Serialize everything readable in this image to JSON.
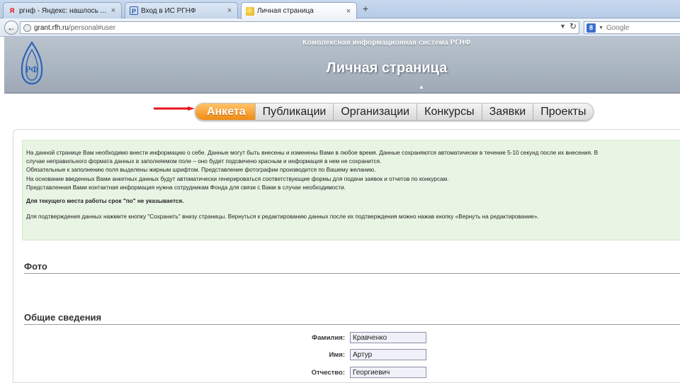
{
  "browser": {
    "tabs": [
      {
        "title": "ргнф - Яндекс: нашлось ...",
        "favicon": "yandex-icon",
        "active": false
      },
      {
        "title": "Вход в ИС РГНФ",
        "favicon": "rgnf-icon",
        "active": false
      },
      {
        "title": "Личная страница",
        "favicon": "loading-dot-icon",
        "active": true
      }
    ],
    "close_glyph": "×",
    "new_tab_glyph": "+",
    "url_host": "grant.rfh.ru",
    "url_path": "/personal#user",
    "search_placeholder": "Google"
  },
  "site": {
    "system_title": "Комплексная информационная система РГНФ",
    "page_title": "Личная страница"
  },
  "menu": {
    "items": [
      "Анкета",
      "Публикации",
      "Организации",
      "Конкурсы",
      "Заявки",
      "Проекты"
    ],
    "active_index": 0
  },
  "info": {
    "lines": [
      "На данной странице Вам необходимо внести информацию о себе. Данные могут быть внесены и изменены Вами в любое время. Данные сохраняются автоматически в течение 5-10 секунд после их внесения. В",
      "случае неправильного формата данных в заполняемом поле – оно будет подсвечено красным и информация в нем не сохранится.",
      "Обязательные к заполнению поля выделены жирным шрифтом. Представление фотографии производится по Вашему желанию.",
      "На основании введенных Вами анкетных данных будут автоматически генерироваться соответствующие формы для подачи заявок и отчетов по конкурсам.",
      "Представленная Вами контактная информация нужна сотрудникам Фонда для связи с Вами в случае необходимости."
    ],
    "bold_note": "Для текущего места работы срок \"по\" не указывается.",
    "confirm_note": "Для подтверждения данных нажмите кнопку \"Сохранить\" внизу страницы. Вернуться к редактированию данных после их подтверждения можно нажав кнопку «Вернуть на редактирование»."
  },
  "sections": {
    "photo": "Фото",
    "general": "Общие сведения"
  },
  "form": {
    "surname_label": "Фамилия:",
    "surname_value": "Кравченко",
    "name_label": "Имя:",
    "name_value": "Артур",
    "patronymic_label": "Отчество:",
    "patronymic_value": "Георгиевич"
  },
  "colors": {
    "active_tab": "#f5a030",
    "info_bg": "#e9f5e4",
    "header_bg": "#aab5c1",
    "arrow": "#e8141c"
  }
}
